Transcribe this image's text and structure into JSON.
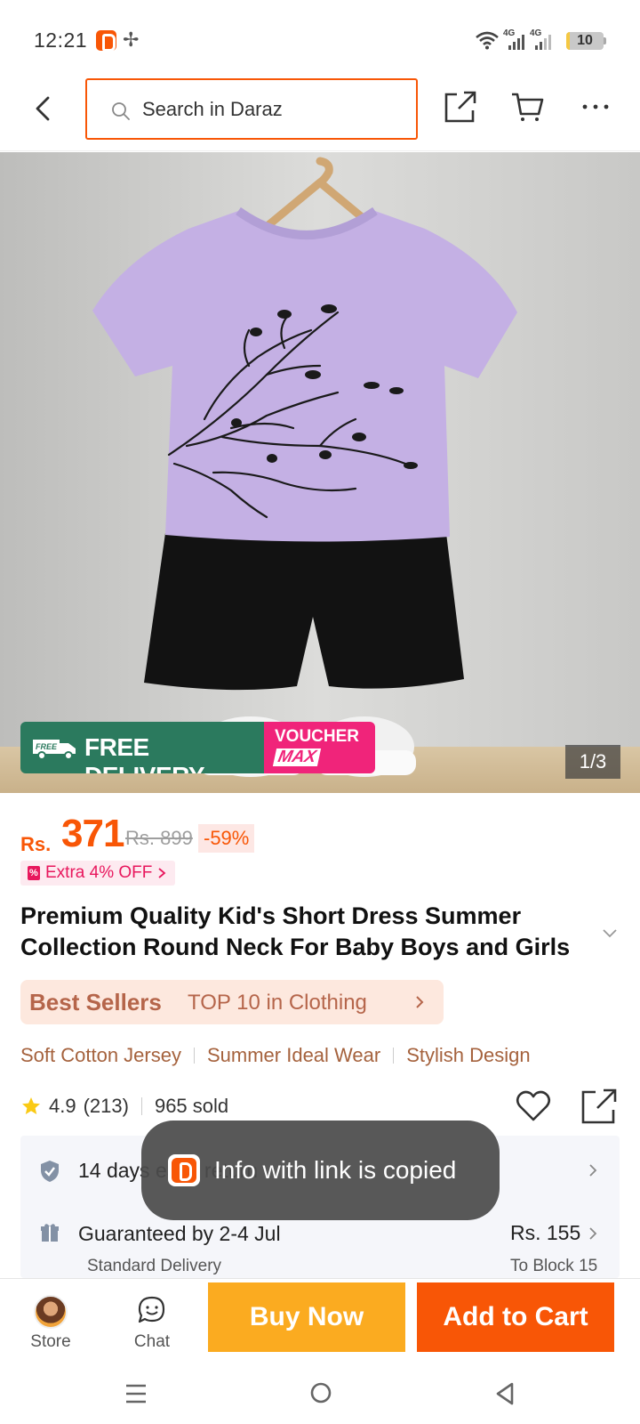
{
  "status_bar": {
    "time": "12:21",
    "network_1": "4G",
    "network_2": "4G",
    "battery": "10",
    "battery_level": 0.1,
    "icons": [
      "daraz-app-icon",
      "pinwheel-icon",
      "wifi-icon",
      "signal-icon",
      "signal-icon",
      "battery-icon"
    ]
  },
  "header": {
    "search_placeholder": "Search in Daraz",
    "icons": [
      "back-arrow-icon",
      "search-icon",
      "share-icon",
      "cart-icon",
      "more-dots-icon"
    ]
  },
  "gallery": {
    "counter": "1/3",
    "promo": {
      "free_badge": "FREE",
      "free_delivery": "FREE DELIVERY",
      "voucher_line1": "VOUCHER",
      "voucher_line2": "MAX"
    }
  },
  "product": {
    "currency": "Rs.",
    "price": "371",
    "original_price": "Rs. 899",
    "discount": "-59%",
    "extra_off": "Extra 4% OFF",
    "title": "Premium Quality Kid's Short Dress Summer Collection Round Neck For Baby Boys and Girls",
    "best_sellers_label": "Best Sellers",
    "best_sellers_text": "TOP 10 in Clothing",
    "features": [
      "Soft Cotton Jersey",
      "Summer Ideal Wear",
      "Stylish Design"
    ],
    "rating": "4.9",
    "reviews": "(213)",
    "sold": "965 sold"
  },
  "service": {
    "returns": "14 days easy return",
    "delivery": "Guaranteed by 2-4 Jul",
    "delivery_type": "Standard Delivery",
    "delivery_price": "Rs. 155",
    "delivery_location": "To Block 15"
  },
  "toast": {
    "message": "Info with link is copied"
  },
  "bottom_bar": {
    "store_label": "Store",
    "chat_label": "Chat",
    "buy_now": "Buy Now",
    "add_to_cart": "Add to Cart"
  },
  "colors": {
    "brand_orange": "#f85606",
    "buy_now_yellow": "#fbab20",
    "voucher_pink": "#f0247a",
    "free_delivery_green": "#2b7a5e"
  }
}
